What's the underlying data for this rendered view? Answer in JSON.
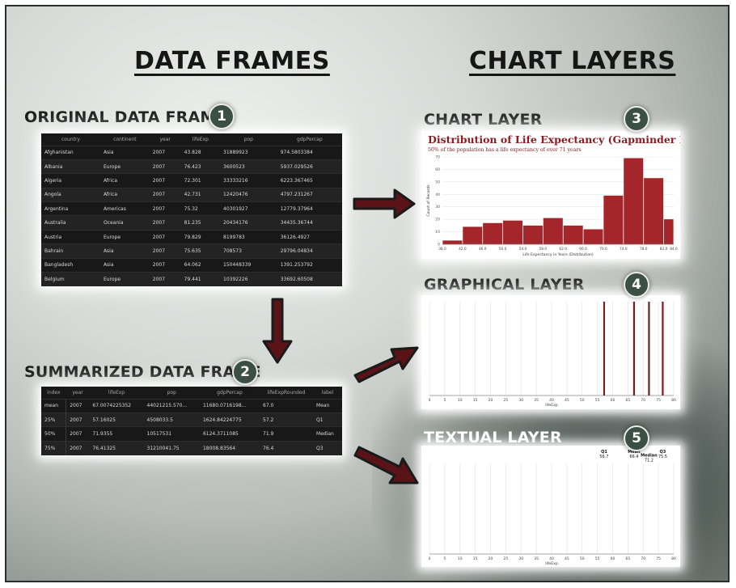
{
  "headers": {
    "data_frames": "DATA FRAMES",
    "chart_layers": "CHART LAYERS"
  },
  "original": {
    "title": "ORIGINAL DATA FRAME",
    "badge": "1",
    "columns": [
      "country",
      "continent",
      "year",
      "lifeExp",
      "pop",
      "gdpPercap"
    ],
    "rows": [
      [
        "Afghanistan",
        "Asia",
        "2007",
        "43.828",
        "31889923",
        "974.5803384"
      ],
      [
        "Albania",
        "Europe",
        "2007",
        "76.423",
        "3600523",
        "5937.029526"
      ],
      [
        "Algeria",
        "Africa",
        "2007",
        "72.301",
        "33333216",
        "6223.367465"
      ],
      [
        "Angola",
        "Africa",
        "2007",
        "42.731",
        "12420476",
        "4797.231267"
      ],
      [
        "Argentina",
        "Americas",
        "2007",
        "75.32",
        "40301927",
        "12779.37964"
      ],
      [
        "Australia",
        "Oceania",
        "2007",
        "81.235",
        "20434176",
        "34435.36744"
      ],
      [
        "Austria",
        "Europe",
        "2007",
        "79.829",
        "8199783",
        "36126.4927"
      ],
      [
        "Bahrain",
        "Asia",
        "2007",
        "75.635",
        "708573",
        "29796.04834"
      ],
      [
        "Bangladesh",
        "Asia",
        "2007",
        "64.062",
        "150448339",
        "1391.253792"
      ],
      [
        "Belgium",
        "Europe",
        "2007",
        "79.441",
        "10392226",
        "33692.60508"
      ]
    ]
  },
  "summarized": {
    "title": "SUMMARIZED DATA FRAME",
    "badge": "2",
    "columns": [
      "index",
      "year",
      "lifeExp",
      "pop",
      "gdpPercap",
      "lifeExpRounded",
      "label"
    ],
    "rows": [
      [
        "mean",
        "2007",
        "67.0074225352",
        "44021215.570...",
        "11680.0716198...",
        "67.0",
        "Mean"
      ],
      [
        "25%",
        "2007",
        "57.16025",
        "4508033.5",
        "1624.84224775",
        "57.2",
        "Q1"
      ],
      [
        "50%",
        "2007",
        "71.9355",
        "10517531",
        "6124.3711085",
        "71.9",
        "Median"
      ],
      [
        "75%",
        "2007",
        "76.41325",
        "31210041.75",
        "18008.83564",
        "76.4",
        "Q3"
      ]
    ]
  },
  "chart_layer": {
    "title": "CHART LAYER",
    "badge": "3"
  },
  "graphical_layer": {
    "title": "GRAPHICAL LAYER",
    "badge": "4"
  },
  "textual_layer": {
    "title": "TEXTUAL LAYER",
    "badge": "5"
  },
  "colors": {
    "bar": "#a4252a",
    "rule": "#7a1b20",
    "arrow_fill": "#5a1418",
    "arrow_stroke": "#1a1a1a",
    "badge": "#3c4f46"
  },
  "chart_data": [
    {
      "type": "bar",
      "title": "Distribution of Life Expectancy (Gapminder Data)",
      "subtitle": "50% of the population has a life expectancy of over 71 years",
      "xlabel": "Life Expectancy in Years (Distribution)",
      "ylabel": "Count of Records",
      "bin_edges": [
        38,
        42,
        46,
        50,
        54,
        58,
        62,
        66,
        70,
        74,
        78,
        82,
        84
      ],
      "x_ticks": [
        "38.0",
        "42.0",
        "46.0",
        "50.0",
        "54.0",
        "58.0",
        "62.0",
        "66.0",
        "70.0",
        "74.0",
        "78.0",
        "82.0",
        "84.0"
      ],
      "values": [
        3,
        14,
        17,
        19,
        15,
        21,
        15,
        12,
        39,
        69,
        53,
        20
      ],
      "ylim": [
        0,
        70
      ],
      "y_ticks": [
        0,
        10,
        20,
        30,
        40,
        50,
        60,
        70
      ]
    },
    {
      "type": "line",
      "xlabel": "lifeExp",
      "xlim": [
        0,
        80
      ],
      "x_ticks": [
        0,
        5,
        10,
        15,
        20,
        25,
        30,
        35,
        40,
        45,
        50,
        55,
        60,
        65,
        70,
        75,
        80
      ],
      "rules": [
        57.2,
        67.0,
        71.9,
        76.4
      ]
    },
    {
      "type": "table",
      "xlabel": "lifeExp",
      "xlim": [
        0,
        80
      ],
      "x_ticks": [
        0,
        5,
        10,
        15,
        20,
        25,
        30,
        35,
        40,
        45,
        50,
        55,
        60,
        65,
        70,
        75,
        80
      ],
      "labels": [
        {
          "label": "Q1",
          "value": "56.7",
          "x": 57.2,
          "row": 0
        },
        {
          "label": "Mean",
          "value": "66.4",
          "x": 67.0,
          "row": 0
        },
        {
          "label": "Median",
          "value": "71.2",
          "x": 71.9,
          "row": 1
        },
        {
          "label": "Q3",
          "value": "75.5",
          "x": 76.4,
          "row": 0
        }
      ]
    }
  ]
}
